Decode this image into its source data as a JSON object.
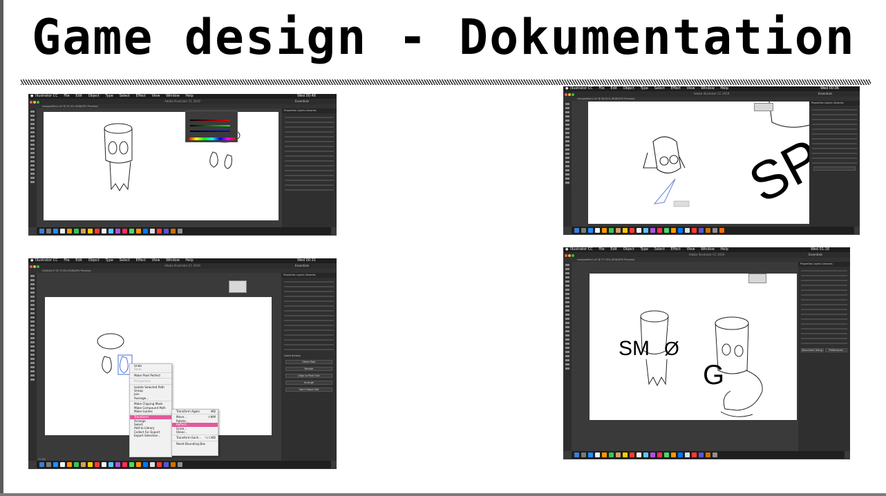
{
  "slide": {
    "title": "Game design - Dokumentation"
  },
  "app": {
    "name": "Illustrator CC",
    "window_title": "Adobe Illustrator CC 2019",
    "workspace": "Essentials"
  },
  "menu": [
    "File",
    "Edit",
    "Object",
    "Type",
    "Select",
    "Effect",
    "View",
    "Window",
    "Help"
  ],
  "screenshots": {
    "s1": {
      "clock": "Wed 00:48",
      "tab": "smogpeltkis1.ai* @ 33.3% (RGB/GPU Preview)",
      "panel_tabs": "Properties  Layers  Libraries"
    },
    "s2": {
      "clock": "Wed 00:06",
      "tab": "smogpeltkis1.ai* @ 36.61% (RGB/GPU Preview)",
      "panel_tabs": "Properties  Layers  Libraries",
      "canvas_text": "SP"
    },
    "s3": {
      "clock": "Wed 00:31",
      "tab": "Untitled-1* @ 72.6% (RGB/GPU Preview)",
      "zoom": "72.6%",
      "panel_tabs": "Properties  Layers  Libraries",
      "panel_section": "Quick Actions",
      "panel_buttons": [
        "Offset Path",
        "Recolor",
        "Align to Pixel Grid",
        "Arrange",
        "Start Global Edit"
      ],
      "context_menu": {
        "items": [
          "Undo",
          "Redo",
          "Make Pixel Perfect",
          "Perspective",
          "Isolate Selected Path",
          "Group",
          "Join",
          "Average...",
          "Make Clipping Mask",
          "Make Compound Path",
          "Make Guides",
          "Transform",
          "Arrange",
          "Select",
          "Add to Library",
          "Collect For Export",
          "Export Selection..."
        ],
        "highlight": "Transform"
      },
      "submenu": {
        "items": [
          "Transform Again",
          "Move...",
          "Rotate...",
          "Reflect...",
          "Scale...",
          "Shear...",
          "Transform Each...",
          "Reset Bounding Box"
        ],
        "shortcuts": [
          "⌘D",
          "⇧⌘M",
          "",
          "",
          "",
          "",
          "⌥⇧⌘D",
          ""
        ],
        "highlight": "Reflect..."
      }
    },
    "s4": {
      "clock": "Wed 01:18",
      "tab": "smogpeltkis1.ai* @ 27.33% (RGB/GPU Preview)",
      "panel_tabs": "Properties  Layers  Libraries",
      "canvas_text_1": "SM",
      "canvas_text_2": "Ø",
      "canvas_text_3": "G",
      "panel_buttons": [
        "Document Setup",
        "Preferences"
      ]
    }
  },
  "colors": {
    "chrome_dark": "#1d1d1d",
    "panel": "#2f2f2f",
    "workspace": "#3a3a3a",
    "highlight": "#e25a9a",
    "selection": "#4a6fd8"
  }
}
